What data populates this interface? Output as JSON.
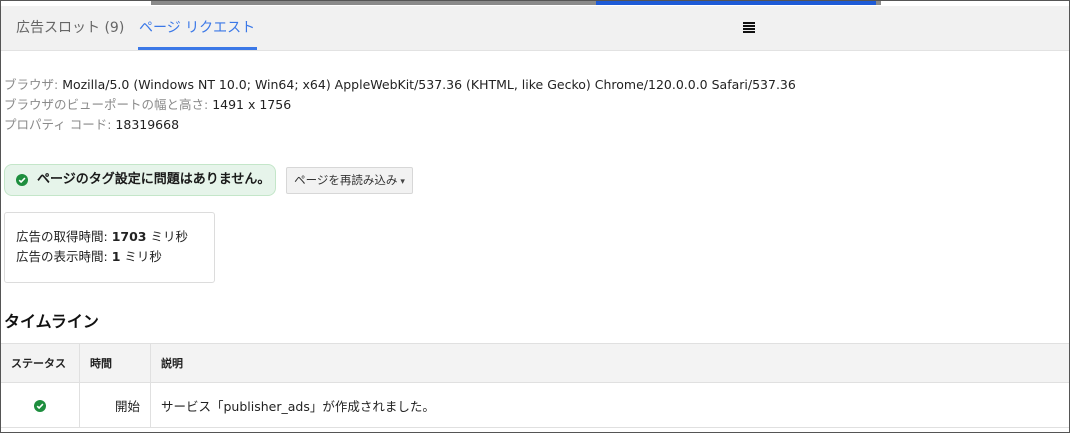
{
  "tabs": {
    "ad_slots": "広告スロット (9)",
    "page_request": "ページ リクエスト"
  },
  "info": {
    "browser_label": "ブラウザ: ",
    "browser_value": "Mozilla/5.0 (Windows NT 10.0; Win64; x64) AppleWebKit/537.36 (KHTML, like Gecko) Chrome/120.0.0.0 Safari/537.36",
    "viewport_label": "ブラウザのビューポートの幅と高さ: ",
    "viewport_value": "1491 x 1756",
    "property_label": "プロパティ コード: ",
    "property_value": "18319668"
  },
  "status": {
    "message": "ページのタグ設定に問題はありません。",
    "icon": "check-circle-icon",
    "color": "#1e8e3e"
  },
  "reload_button": {
    "label": "ページを再読み込み",
    "caret": "▾"
  },
  "timing": {
    "fetch_label": "広告の取得時間: ",
    "fetch_value": "1703",
    "fetch_unit": " ミリ秒",
    "render_label": "広告の表示時間: ",
    "render_value": "1",
    "render_unit": " ミリ秒"
  },
  "timeline": {
    "title": "タイムライン",
    "headers": {
      "status": "ステータス",
      "time": "時間",
      "description": "説明"
    },
    "rows": [
      {
        "status_icon": "check-circle-icon",
        "time": "開始",
        "description": "サービス「publisher_ads」が作成されました。"
      }
    ]
  },
  "menu_icon": "menu-lines-icon",
  "accent_color": "#3b78e7"
}
